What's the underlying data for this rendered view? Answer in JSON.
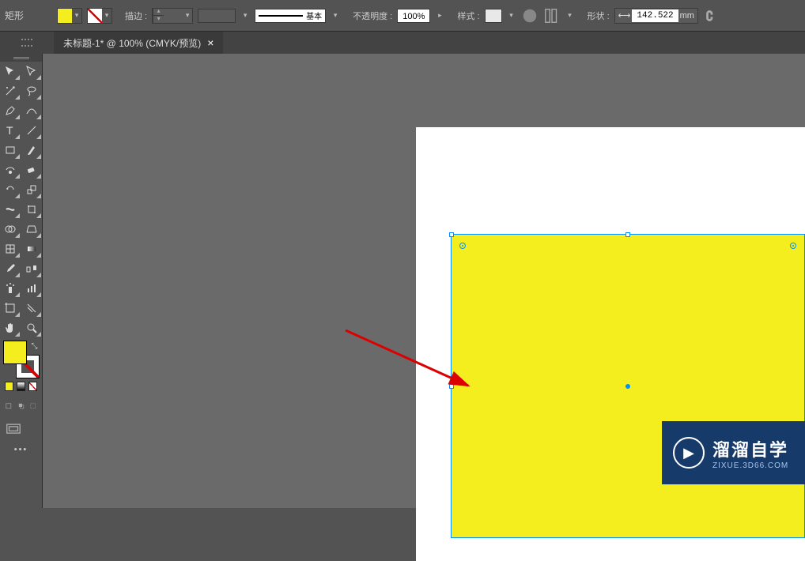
{
  "tool_label": "矩形",
  "stroke": {
    "label": "描边 :",
    "value": "",
    "preview_text": "基本"
  },
  "opacity": {
    "label": "不透明度 :",
    "value": "100%"
  },
  "style": {
    "label": "样式 :"
  },
  "shape": {
    "label": "形状 :",
    "width_icon": "⟷",
    "value": "142.522",
    "unit": "mm"
  },
  "tab": {
    "title": "未标题-1* @ 100% (CMYK/预览)"
  },
  "colors": {
    "fill": "#f5ee1e",
    "stroke": "none",
    "artboard": "#ffffff",
    "selection": "#0090ff"
  },
  "watermark": {
    "title": "溜溜自学",
    "subtitle": "ZIXUE.3D66.COM",
    "play_icon": "▶"
  },
  "toolbar_tools": [
    [
      "selection-tool",
      "direct-selection-tool"
    ],
    [
      "magic-wand-tool",
      "lasso-tool"
    ],
    [
      "pen-tool",
      "curvature-tool"
    ],
    [
      "type-tool",
      "line-tool"
    ],
    [
      "rectangle-tool",
      "paintbrush-tool"
    ],
    [
      "shaper-tool",
      "eraser-tool"
    ],
    [
      "rotate-tool",
      "scale-tool"
    ],
    [
      "width-tool",
      "free-transform-tool"
    ],
    [
      "shape-builder-tool",
      "perspective-grid-tool"
    ],
    [
      "mesh-tool",
      "gradient-tool"
    ],
    [
      "eyedropper-tool",
      "blend-tool"
    ],
    [
      "symbol-sprayer-tool",
      "column-graph-tool"
    ],
    [
      "artboard-tool",
      "slice-tool"
    ],
    [
      "hand-tool",
      "zoom-tool"
    ]
  ]
}
